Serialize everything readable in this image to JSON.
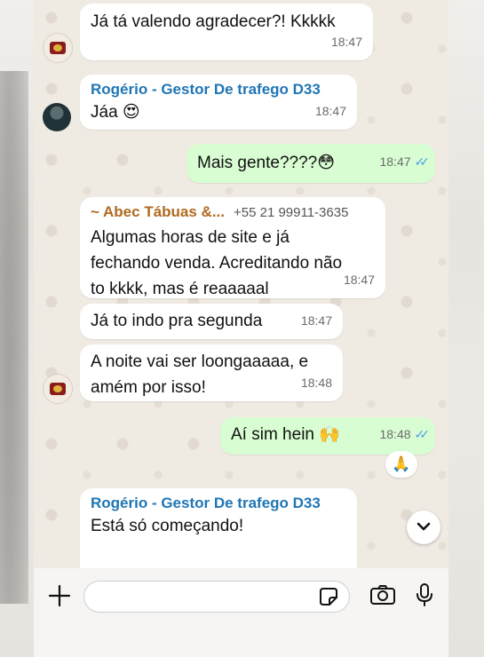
{
  "messages": [
    {
      "text": "Já tá valendo agradecer?! Kkkkk",
      "time": "18:47"
    },
    {
      "sender": "Rogério - Gestor De trafego D33",
      "text": "Jáa 😍",
      "time": "18:47"
    },
    {
      "text": "Mais gente????😳",
      "time": "18:47",
      "ticks": "✓✓"
    },
    {
      "sender": "~ Abec Tábuas &...",
      "phone": "+55 21 99911-3635",
      "text": "Algumas horas de site e já\nfechando venda. Acreditando não\nto kkkk, mas é reaaaaal",
      "time": "18:47"
    },
    {
      "text": "Já to indo pra segunda",
      "time": "18:47"
    },
    {
      "text": "A noite vai ser loongaaaaa, e\namém por isso!",
      "time": "18:48"
    },
    {
      "text": "Aí sim hein 🙌",
      "time": "18:48",
      "ticks": "✓✓",
      "reaction": "🙏"
    },
    {
      "sender": "Rogério - Gestor De trafego D33",
      "text": "Está só começando!\n\nIsso que ele está em fase de"
    }
  ],
  "input": {
    "placeholder": ""
  },
  "icons": {
    "attach": "plus-icon",
    "sticker": "sticker-icon",
    "camera": "camera-icon",
    "mic": "microphone-icon",
    "scroll": "chevron-down-icon"
  },
  "colors": {
    "outgoing": "#d9fdd3",
    "incoming": "#ffffff",
    "sender_blue": "#1f76b5",
    "sender_brown": "#b06a1f",
    "read_ticks": "#4aa0e6"
  }
}
